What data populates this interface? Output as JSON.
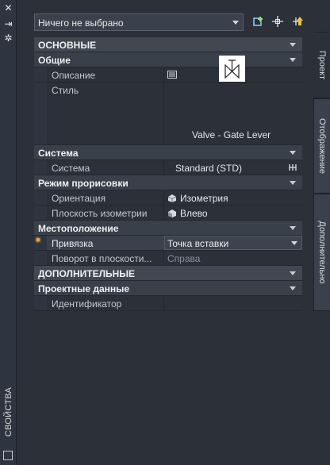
{
  "strip": {
    "title": "СВОЙСТВА",
    "icons": [
      "close-icon",
      "pin-icon",
      "settings-icon",
      "panel-icon"
    ]
  },
  "toolbar": {
    "selection": "Ничего не выбрано",
    "buttons": [
      "toggle-pickadd-icon",
      "select-objects-icon",
      "quick-select-icon"
    ]
  },
  "sections": {
    "basic": "ОСНОВНЫЕ",
    "general": "Общие",
    "description_label": "Описание",
    "style_label": "Стиль",
    "style_value": "Valve - Gate Lever",
    "system_group": "Система",
    "system_label": "Система",
    "system_value": "Standard (STD)",
    "draw_mode": "Режим прорисовки",
    "orientation_label": "Ориентация",
    "orientation_value": "Изометрия",
    "iso_plane_label": "Плоскость изометрии",
    "iso_plane_value": "Влево",
    "location": "Местоположение",
    "anchor_label": "Привязка",
    "anchor_value": "Точка вставки",
    "rotation_label": "Поворот в плоскости...",
    "rotation_value": "Справа",
    "additional": "ДОПОЛНИТЕЛЬНЫЕ",
    "project_data": "Проектные данные",
    "id_label": "Идентификатор"
  },
  "tabs": [
    "Проект",
    "Отображение",
    "Дополнительно"
  ],
  "colors": {
    "accent": "#e7a33c",
    "panel": "#2b3039",
    "category": "#414852"
  }
}
